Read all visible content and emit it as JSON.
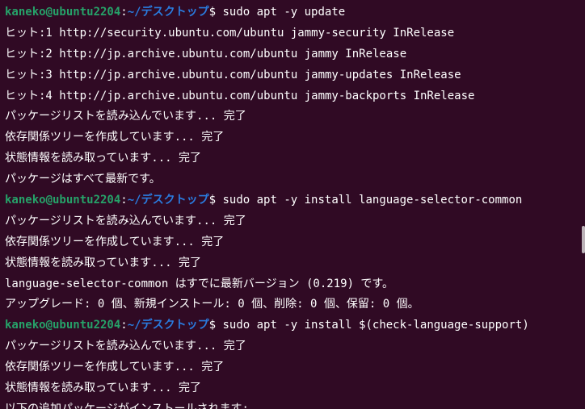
{
  "terminal": {
    "prompt": {
      "user_host": "kaneko@ubuntu2204",
      "separator": ":",
      "path": "~/デスクトップ",
      "symbol": "$"
    },
    "commands": [
      " sudo apt -y update",
      " sudo apt -y install language-selector-common",
      " sudo apt -y install $(check-language-support)"
    ],
    "output": {
      "update": [
        "ヒット:1 http://security.ubuntu.com/ubuntu jammy-security InRelease",
        "ヒット:2 http://jp.archive.ubuntu.com/ubuntu jammy InRelease",
        "ヒット:3 http://jp.archive.ubuntu.com/ubuntu jammy-updates InRelease",
        "ヒット:4 http://jp.archive.ubuntu.com/ubuntu jammy-backports InRelease",
        "パッケージリストを読み込んでいます... 完了",
        "依存関係ツリーを作成しています... 完了",
        "状態情報を読み取っています... 完了",
        "パッケージはすべて最新です。"
      ],
      "install_common": [
        "パッケージリストを読み込んでいます... 完了",
        "依存関係ツリーを作成しています... 完了",
        "状態情報を読み取っています... 完了",
        "language-selector-common はすでに最新バージョン (0.219) です。",
        "アップグレード: 0 個、新規インストール: 0 個、削除: 0 個、保留: 0 個。"
      ],
      "install_support": [
        "パッケージリストを読み込んでいます... 完了",
        "依存関係ツリーを作成しています... 完了",
        "状態情報を読み取っています... 完了",
        "以下の追加パッケージがインストールされます:"
      ]
    }
  },
  "colors": {
    "background": "#300a24",
    "prompt_user": "#26a269",
    "prompt_path": "#2a7bde",
    "text": "#ffffff"
  }
}
